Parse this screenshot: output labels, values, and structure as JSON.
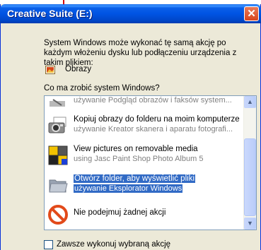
{
  "window": {
    "title": "Creative Suite (E:)"
  },
  "description": "System Windows może wykonać tę samą akcję po każdym włożeniu dysku lub podłączeniu urządzenia z takim plikiem:",
  "content_type": {
    "label": "Obrazy",
    "icon": "images-icon"
  },
  "question": "Co ma zrobić system Windows?",
  "actions": [
    {
      "title": "",
      "subtitle": "używanie Podgląd obrazów i faksów system...",
      "icon": "fax-viewer-icon",
      "selected": false
    },
    {
      "title": "Kopiuj obrazy do folderu na moim komputerze",
      "subtitle": "używanie Kreator skanera i aparatu fotografi...",
      "icon": "camera-icon",
      "selected": false
    },
    {
      "title": "View pictures on removable media",
      "subtitle": "using Jasc Paint Shop Photo Album 5",
      "icon": "photo-album-icon",
      "selected": false
    },
    {
      "title": "Otwórz folder, aby wyświetlić pliki",
      "subtitle": "używanie Eksplorator Windows",
      "icon": "folder-icon",
      "selected": true
    },
    {
      "title": "Nie podejmuj żadnej akcji",
      "subtitle": "",
      "icon": "no-action-icon",
      "selected": false
    }
  ],
  "always_checkbox": {
    "label": "Zawsze wykonuj wybraną akcję",
    "checked": false
  },
  "colors": {
    "titlebar": "#0054e3",
    "selection": "#316ac5",
    "dialog_bg": "#ece9d8"
  }
}
